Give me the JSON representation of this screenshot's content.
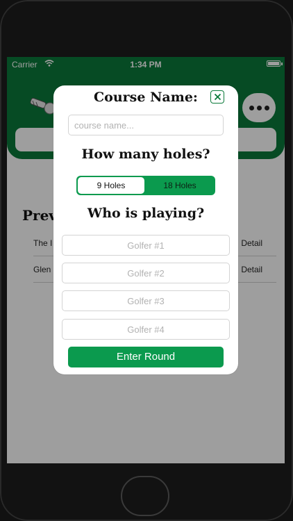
{
  "status_bar": {
    "carrier": "Carrier",
    "time": "1:34 PM"
  },
  "app": {
    "section_title": "Previ",
    "rows": [
      {
        "name": "The I",
        "detail": "Detail"
      },
      {
        "name": "Glen",
        "detail": "Detail"
      }
    ]
  },
  "modal": {
    "title": "Course Name:",
    "course_placeholder": "course name...",
    "holes_question": "How many holes?",
    "hole_options": [
      "9 Holes",
      "18 Holes"
    ],
    "selected_holes": "9 Holes",
    "players_question": "Who is playing?",
    "golfer_placeholders": [
      "Golfer #1",
      "Golfer #2",
      "Golfer #3",
      "Golfer #4"
    ],
    "submit_label": "Enter Round"
  },
  "colors": {
    "brand_green": "#0b7a3a",
    "button_green": "#0b9a4e"
  },
  "icons": {
    "close": "close-x-icon",
    "more": "ellipsis-icon",
    "logo": "golf-logo-icon",
    "wifi": "wifi-icon",
    "battery": "battery-icon"
  }
}
